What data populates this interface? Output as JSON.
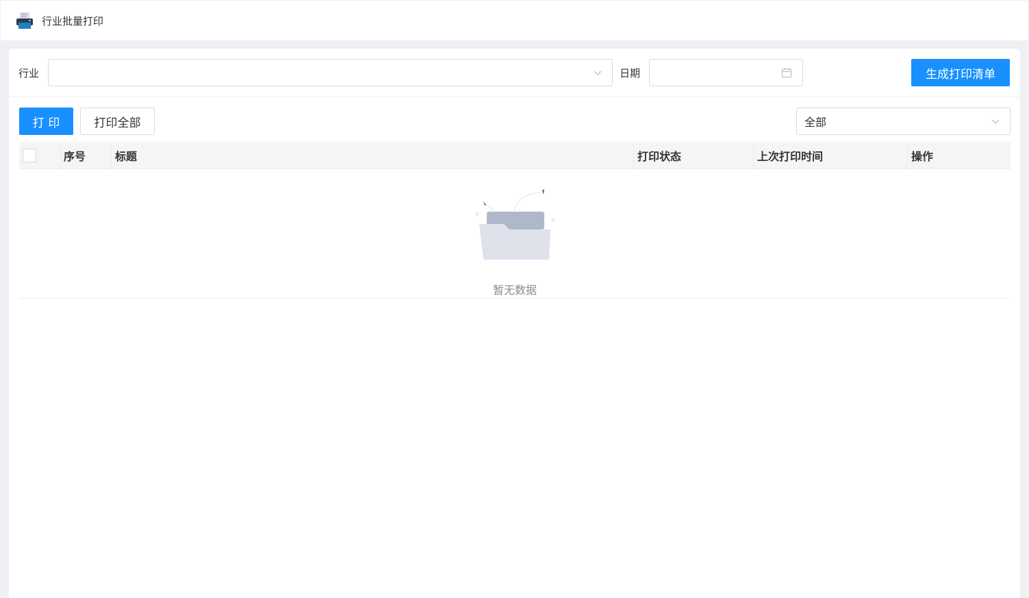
{
  "window": {
    "title": "行业批量打印",
    "icon": "printer-icon"
  },
  "filters": {
    "industry_label": "行业",
    "industry_value": "",
    "date_label": "日期",
    "date_value": "",
    "generate_button": "生成打印清单"
  },
  "toolbar": {
    "print_button": "打 印",
    "print_all_button": "打印全部",
    "status_filter_value": "全部"
  },
  "table": {
    "columns": [
      "序号",
      "标题",
      "打印状态",
      "上次打印时间",
      "操作"
    ],
    "rows": [],
    "empty_text": "暂无数据"
  },
  "colors": {
    "primary": "#1890ff",
    "page_bg": "#eef0f4",
    "header_bg": "#f5f5f5"
  }
}
